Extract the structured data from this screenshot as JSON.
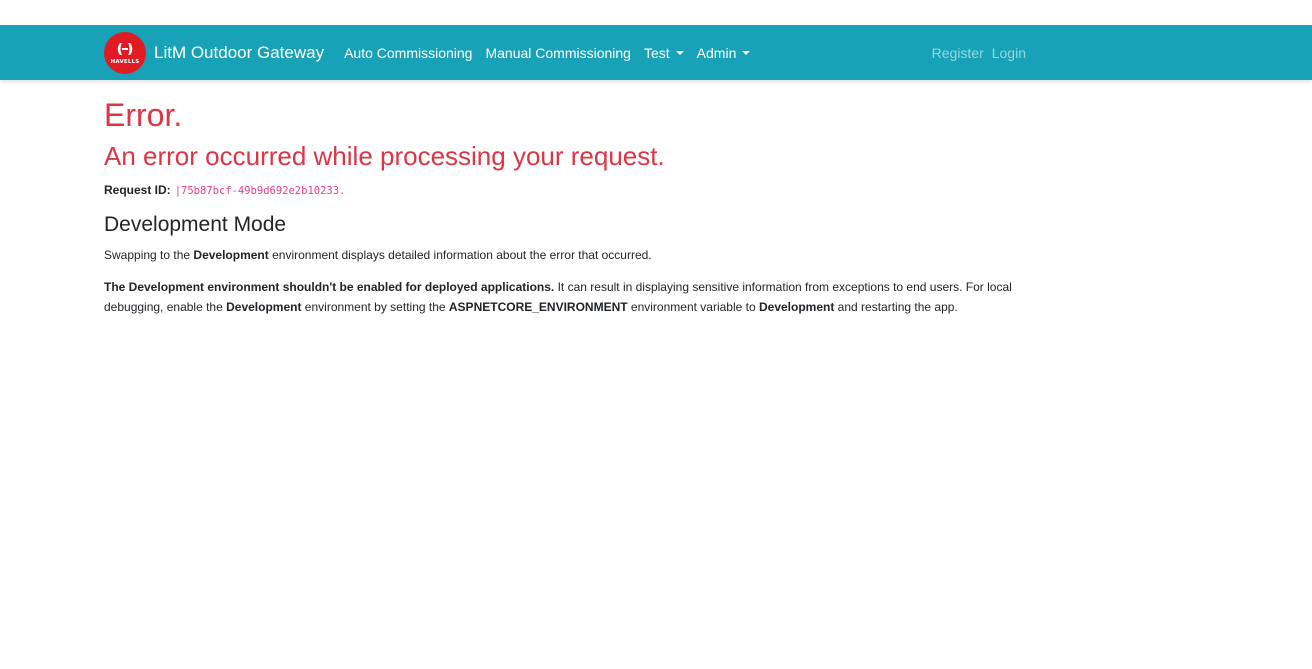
{
  "navbar": {
    "logo_text": "HAVELLS",
    "brand": "LitM Outdoor Gateway",
    "items": [
      {
        "label": "Auto Commissioning",
        "dropdown": false
      },
      {
        "label": "Manual Commissioning",
        "dropdown": false
      },
      {
        "label": "Test",
        "dropdown": true
      },
      {
        "label": "Admin",
        "dropdown": true
      }
    ],
    "register": "Register",
    "login": "Login"
  },
  "main": {
    "title": "Error.",
    "subtitle": "An error occurred while processing your request.",
    "request_label": "Request ID:",
    "request_id": "|75b87bcf-49b9d692e2b10233.",
    "dev_heading": "Development Mode",
    "p1_a": "Swapping to the ",
    "p1_b": "Development",
    "p1_c": " environment displays detailed information about the error that occurred.",
    "p2_a": "The Development environment shouldn't be enabled for deployed applications.",
    "p2_b": " It can result in displaying sensitive information from exceptions to end users. For local debugging, enable the ",
    "p2_c": "Development",
    "p2_d": " environment by setting the ",
    "p2_e": "ASPNETCORE_ENVIRONMENT",
    "p2_f": " environment variable to ",
    "p2_g": "Development",
    "p2_h": " and restarting the app."
  },
  "colors": {
    "navbar": "#17a2b8",
    "danger": "#dc3545",
    "code": "#e83e8c",
    "logo": "#e01b24"
  }
}
